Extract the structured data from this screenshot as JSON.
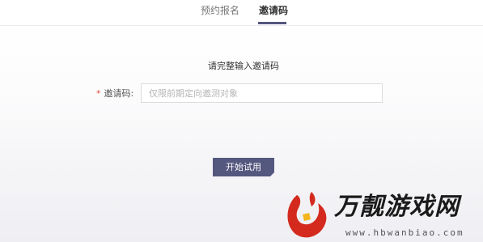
{
  "tabs": [
    {
      "label": "预约报名",
      "active": false
    },
    {
      "label": "邀请码",
      "active": true
    }
  ],
  "form": {
    "prompt": "请完整输入邀请码",
    "required_mark": "*",
    "field_label": "邀请码:",
    "field_value": "",
    "field_placeholder": "仅限前期定向邀测对象",
    "submit_label": "开始试用"
  },
  "watermark": {
    "title": "万靓游戏网",
    "url": "www.hbwanbiao.com"
  },
  "colors": {
    "accent": "#54577e",
    "required": "#e4513c",
    "logo_red": "#d42a1e",
    "logo_yellow": "#f3b51b"
  }
}
